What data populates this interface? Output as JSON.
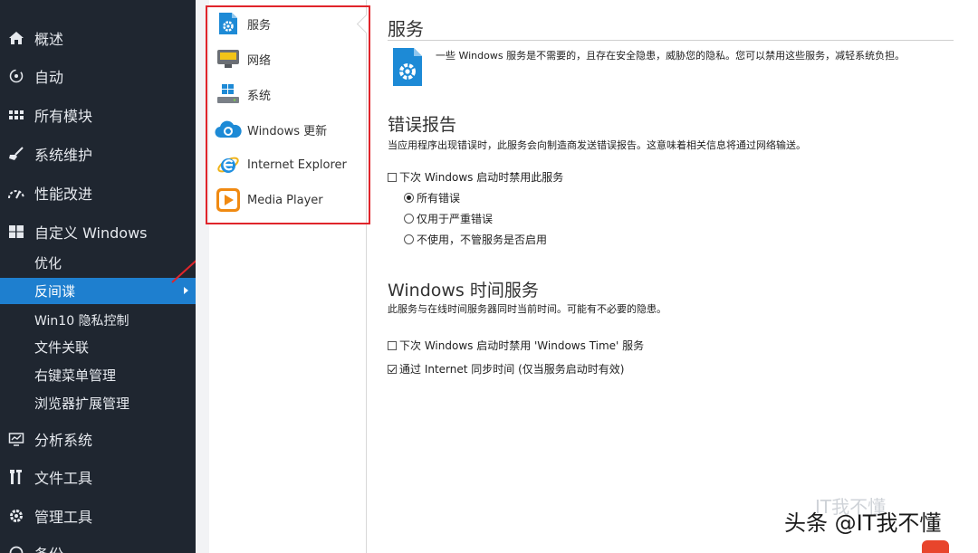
{
  "sidebar": {
    "items": [
      {
        "label": "概述",
        "icon": "home-icon"
      },
      {
        "label": "自动",
        "icon": "auto-icon"
      },
      {
        "label": "所有模块",
        "icon": "grid-icon"
      },
      {
        "label": "系统维护",
        "icon": "broom-icon"
      },
      {
        "label": "性能改进",
        "icon": "speed-icon"
      },
      {
        "label": "自定义 Windows",
        "icon": "windows-icon"
      }
    ],
    "subitems": [
      {
        "label": "优化"
      },
      {
        "label": "反间谍",
        "active": true
      },
      {
        "label": "Win10 隐私控制"
      },
      {
        "label": "文件关联"
      },
      {
        "label": "右键菜单管理"
      },
      {
        "label": "浏览器扩展管理"
      }
    ],
    "bottom_items": [
      {
        "label": "分析系统",
        "icon": "analyze-icon"
      },
      {
        "label": "文件工具",
        "icon": "tools-icon"
      },
      {
        "label": "管理工具",
        "icon": "gear-icon"
      },
      {
        "label": "备份",
        "icon": "backup-icon"
      }
    ]
  },
  "categories": [
    {
      "label": "服务",
      "icon": "service-icon"
    },
    {
      "label": "网络",
      "icon": "network-icon"
    },
    {
      "label": "系统",
      "icon": "system-icon"
    },
    {
      "label": "Windows 更新",
      "icon": "update-icon"
    },
    {
      "label": "Internet Explorer",
      "icon": "ie-icon"
    },
    {
      "label": "Media Player",
      "icon": "media-player-icon"
    }
  ],
  "content": {
    "title": "服务",
    "intro": "一些 Windows 服务是不需要的，且存在安全隐患，威胁您的隐私。您可以禁用这些服务，减轻系统负担。",
    "error_report": {
      "title": "错误报告",
      "desc": "当应用程序出现错误时，此服务会向制造商发送错误报告。这意味着相关信息将通过网络输送。",
      "disable_label": "下次 Windows 启动时禁用此服务",
      "disable_checked": false,
      "radios": [
        {
          "label": "所有错误",
          "checked": true
        },
        {
          "label": "仅用于严重错误",
          "checked": false
        },
        {
          "label": "不使用，不管服务是否启用",
          "checked": false
        }
      ]
    },
    "time_service": {
      "title": "Windows 时间服务",
      "desc": "此服务与在线时间服务器同时当前时间。可能有不必要的隐患。",
      "disable_label": "下次 Windows 启动时禁用 'Windows Time' 服务",
      "disable_checked": false,
      "sync_label": "通过 Internet 同步时间 (仅当服务启动时有效)",
      "sync_checked": true
    }
  },
  "watermark": {
    "faint": "IT我不懂",
    "main": "头条 @IT我不懂"
  },
  "colors": {
    "sidebar_bg": "#1f2630",
    "active": "#1e7fcf",
    "highlight": "#e0252b"
  }
}
